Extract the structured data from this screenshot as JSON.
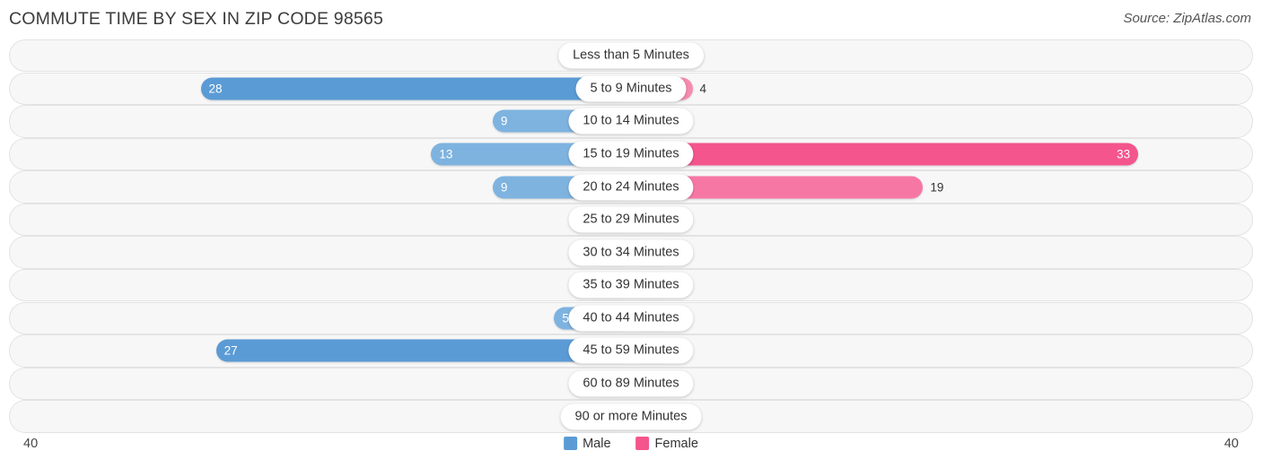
{
  "header": {
    "title": "COMMUTE TIME BY SEX IN ZIP CODE 98565",
    "source": "Source: ZipAtlas.com"
  },
  "legend": {
    "male_label": "Male",
    "female_label": "Female",
    "male_color": "#5b9bd5",
    "female_color": "#f4558c"
  },
  "axis": {
    "left_label": "40",
    "right_label": "40",
    "max": 40
  },
  "chart_data": {
    "type": "bar",
    "orientation": "horizontal-diverging",
    "title": "COMMUTE TIME BY SEX IN ZIP CODE 98565",
    "xlabel": "",
    "ylabel": "",
    "xlim": [
      40,
      40
    ],
    "grid": false,
    "legend_position": "bottom-center",
    "categories": [
      "Less than 5 Minutes",
      "5 to 9 Minutes",
      "10 to 14 Minutes",
      "15 to 19 Minutes",
      "20 to 24 Minutes",
      "25 to 29 Minutes",
      "30 to 34 Minutes",
      "35 to 39 Minutes",
      "40 to 44 Minutes",
      "45 to 59 Minutes",
      "60 to 89 Minutes",
      "90 or more Minutes"
    ],
    "series": [
      {
        "name": "Male",
        "values": [
          0,
          28,
          9,
          13,
          9,
          0,
          0,
          0,
          5,
          27,
          0,
          0
        ]
      },
      {
        "name": "Female",
        "values": [
          0,
          4,
          0,
          33,
          19,
          0,
          0,
          0,
          0,
          0,
          0,
          0
        ]
      }
    ]
  },
  "rows": [
    {
      "label": "Less than 5 Minutes",
      "male": "0",
      "female": "0",
      "male_value": 0,
      "female_value": 0
    },
    {
      "label": "5 to 9 Minutes",
      "male": "28",
      "female": "4",
      "male_value": 28,
      "female_value": 4
    },
    {
      "label": "10 to 14 Minutes",
      "male": "9",
      "female": "0",
      "male_value": 9,
      "female_value": 0
    },
    {
      "label": "15 to 19 Minutes",
      "male": "13",
      "female": "33",
      "male_value": 13,
      "female_value": 33
    },
    {
      "label": "20 to 24 Minutes",
      "male": "9",
      "female": "19",
      "male_value": 9,
      "female_value": 19
    },
    {
      "label": "25 to 29 Minutes",
      "male": "0",
      "female": "0",
      "male_value": 0,
      "female_value": 0
    },
    {
      "label": "30 to 34 Minutes",
      "male": "0",
      "female": "0",
      "male_value": 0,
      "female_value": 0
    },
    {
      "label": "35 to 39 Minutes",
      "male": "0",
      "female": "0",
      "male_value": 0,
      "female_value": 0
    },
    {
      "label": "40 to 44 Minutes",
      "male": "5",
      "female": "0",
      "male_value": 5,
      "female_value": 0
    },
    {
      "label": "45 to 59 Minutes",
      "male": "27",
      "female": "0",
      "male_value": 27,
      "female_value": 0
    },
    {
      "label": "60 to 89 Minutes",
      "male": "0",
      "female": "0",
      "male_value": 0,
      "female_value": 0
    },
    {
      "label": "90 or more Minutes",
      "male": "0",
      "female": "0",
      "male_value": 0,
      "female_value": 0
    }
  ]
}
